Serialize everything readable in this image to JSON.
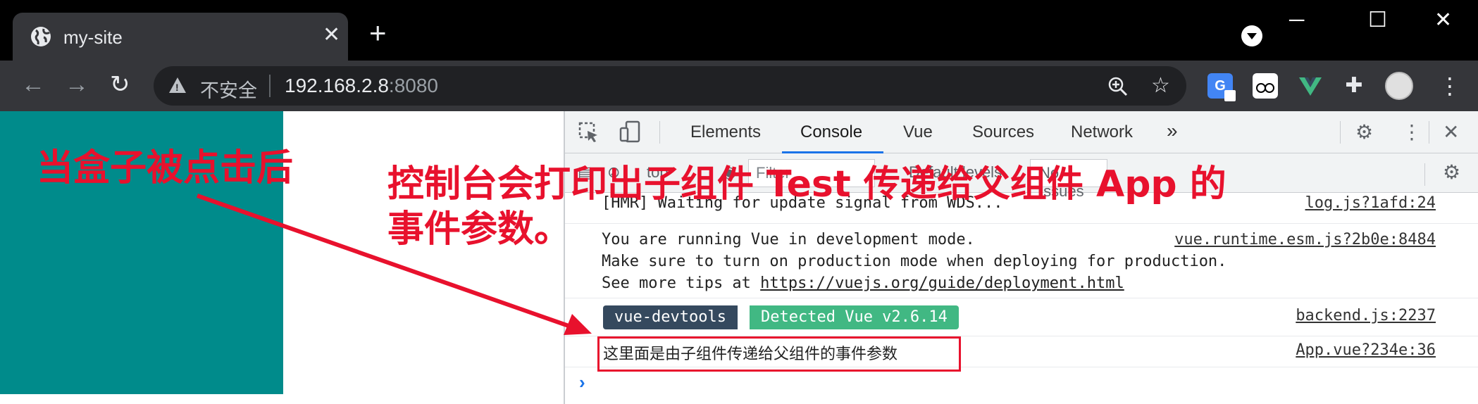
{
  "browser": {
    "tab": {
      "title": "my-site",
      "icon": "globe-icon",
      "close_icon": "close-icon"
    },
    "new_tab_glyph": "+",
    "window_controls": {
      "minimize": "─",
      "maximize": "☐",
      "close": "✕"
    },
    "toolbar": {
      "back_icon": "arrow-left-icon",
      "forward_icon": "arrow-right-icon",
      "reload_icon": "reload-icon",
      "security_label": "不安全",
      "url_host": "192.168.2.8",
      "url_port": ":8080",
      "zoom_icon": "zoom-icon",
      "bookmark_icon": "star-icon",
      "translate_glyph": "G",
      "extensions": [
        "google-translate-icon",
        "cat-icon",
        "vue-devtools-icon",
        "puzzle-icon"
      ],
      "menu_glyph": "⋮"
    }
  },
  "page": {
    "box_color": "#008b8b"
  },
  "devtools": {
    "tabs": [
      "Elements",
      "Console",
      "Vue",
      "Sources",
      "Network"
    ],
    "active_tab": "Console",
    "more_tabs_glyph": "»",
    "filter_bar": {
      "context": "top",
      "filter_placeholder": "Filter",
      "levels": "Default levels",
      "issues": "No Issues"
    },
    "console": [
      {
        "text": "[HMR] Waiting for update signal from WDS...",
        "source": "log.js?1afd:24"
      },
      {
        "lines": [
          "You are running Vue in development mode.",
          "Make sure to turn on production mode when deploying for production.",
          "See more tips at "
        ],
        "link": "https://vuejs.org/guide/deployment.html",
        "source": "vue.runtime.esm.js?2b0e:8484"
      },
      {
        "badge_left": "vue-devtools",
        "badge_right": "Detected Vue v2.6.14",
        "source": "backend.js:2237"
      },
      {
        "text": "这里面是由子组件传递给父组件的事件参数",
        "source": "App.vue?234e:36"
      }
    ],
    "prompt_glyph": "›"
  },
  "annotations": {
    "left": "当盒子被点击后",
    "right_line1": "控制台会打印出子组件 Test 传递给父组件 App 的",
    "right_line2": "事件参数。",
    "color": "#e8112d"
  }
}
